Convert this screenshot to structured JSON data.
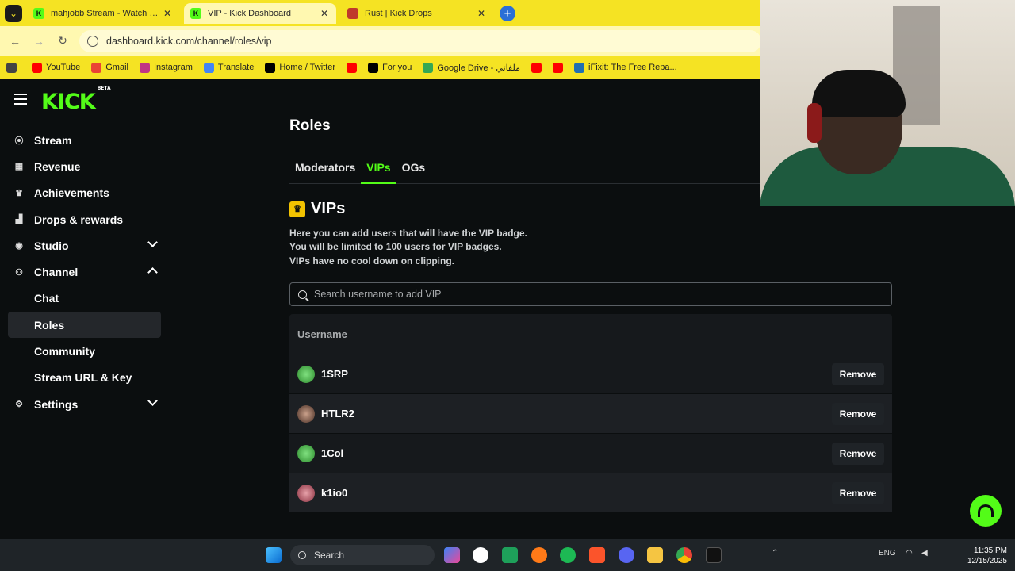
{
  "browser": {
    "tabs": [
      {
        "title": "mahjobb Stream - Watch Live o",
        "favicon_color": "#53fc18",
        "favicon_letter": "K"
      },
      {
        "title": "VIP - Kick Dashboard",
        "favicon_color": "#53fc18",
        "favicon_letter": "K"
      },
      {
        "title": "Rust | Kick Drops",
        "favicon_color": "#c0392b",
        "favicon_letter": ""
      }
    ],
    "url": "dashboard.kick.com/channel/roles/vip",
    "bookmarks": [
      {
        "label": "YouTube",
        "color": "#ff0000"
      },
      {
        "label": "Gmail",
        "color": "#ea4335"
      },
      {
        "label": "Instagram",
        "color": "#c13584"
      },
      {
        "label": "Translate",
        "color": "#4285f4"
      },
      {
        "label": "Home / Twitter",
        "color": "#000000"
      },
      {
        "label": "",
        "color": "#ff0000"
      },
      {
        "label": "For you",
        "color": "#000000"
      },
      {
        "label": "Google Drive - ملفاتي",
        "color": "#34a853"
      },
      {
        "label": "",
        "color": "#ff0000"
      },
      {
        "label": "",
        "color": "#ff0000"
      },
      {
        "label": "iFixit: The Free Repa...",
        "color": "#1f6fb2"
      }
    ]
  },
  "app": {
    "logo": "KICK",
    "logo_badge": "BETA",
    "accent": "#53fc18"
  },
  "sidebar": {
    "items": [
      {
        "label": "Stream",
        "icon": "broadcast-icon",
        "glyph": "((·))"
      },
      {
        "label": "Revenue",
        "icon": "chart-icon",
        "glyph": "▦"
      },
      {
        "label": "Achievements",
        "icon": "trophy-icon",
        "glyph": "♛"
      },
      {
        "label": "Drops & rewards",
        "icon": "drops-icon",
        "glyph": "▟"
      },
      {
        "label": "Studio",
        "icon": "studio-icon",
        "glyph": "◉"
      },
      {
        "label": "Channel",
        "icon": "channel-icon",
        "glyph": "⚇"
      },
      {
        "label": "Chat"
      },
      {
        "label": "Roles"
      },
      {
        "label": "Community"
      },
      {
        "label": "Stream URL & Key"
      },
      {
        "label": "Settings",
        "icon": "gear-icon",
        "glyph": "⚙"
      }
    ]
  },
  "main": {
    "title": "Roles",
    "tabs": [
      "Moderators",
      "VIPs",
      "OGs"
    ],
    "active_tab": "VIPs",
    "section_title": "VIPs",
    "description": [
      "Here you can add users that will have the VIP badge.",
      "You will be limited to 100 users for VIP badges.",
      "VIPs have no cool down on clipping."
    ],
    "search_placeholder": "Search username to add VIP",
    "table_header": "Username",
    "remove_label": "Remove",
    "users": [
      {
        "name": "1SRP",
        "avatar_color": "#3fae3f"
      },
      {
        "name": "HTLR2",
        "avatar_color": "#6b4a3a"
      },
      {
        "name": "1Col",
        "avatar_color": "#3fae3f"
      },
      {
        "name": "k1io0",
        "avatar_color": "#b05060"
      }
    ]
  },
  "taskbar": {
    "search_label": "Search",
    "language": "ENG",
    "time": "11:35 PM",
    "date": "12/15/2025"
  }
}
